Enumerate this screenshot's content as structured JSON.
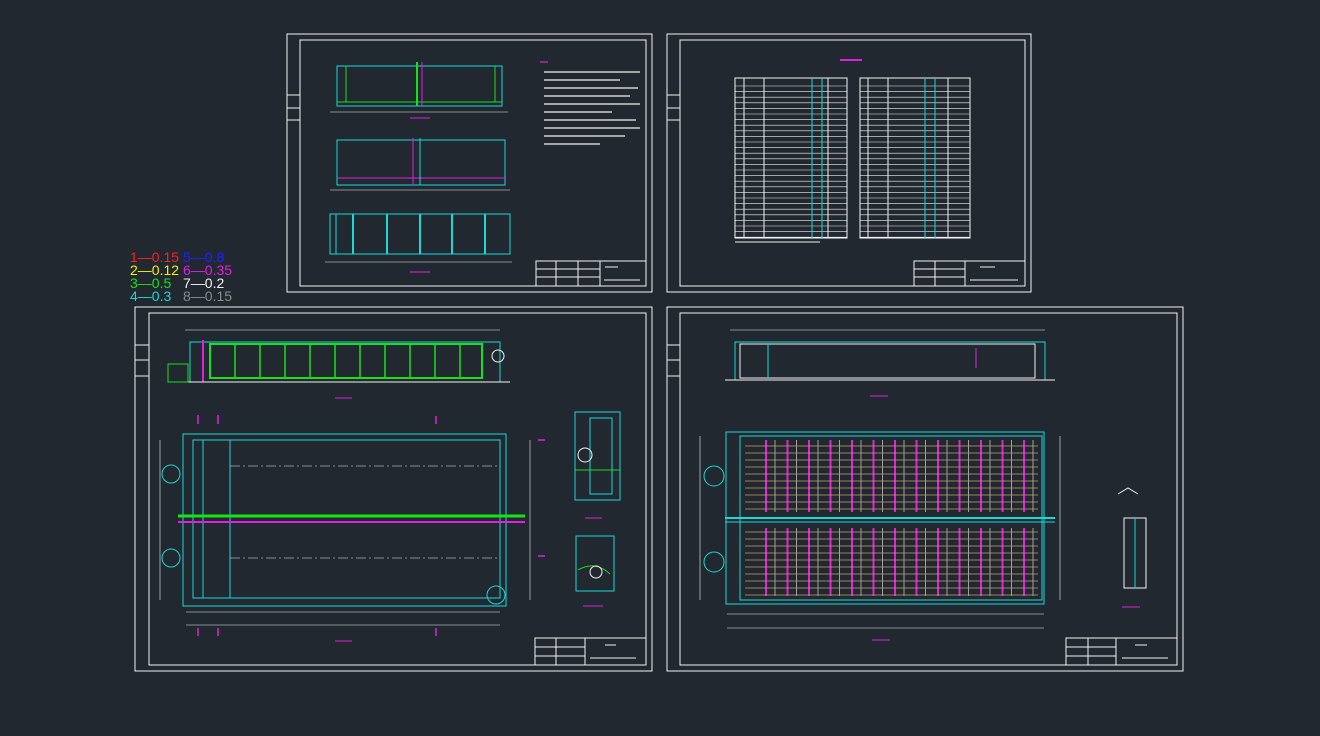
{
  "lineweight_legend": [
    {
      "text": "1—0.15",
      "color": "#ff2020"
    },
    {
      "text": "2—0.12",
      "color": "#f2f200"
    },
    {
      "text": "3—0.5",
      "color": "#19e019"
    },
    {
      "text": "4—0.3",
      "color": "#19d8d8"
    },
    {
      "text": "5—0.8",
      "color": "#2020ff"
    },
    {
      "text": "6—0.35",
      "color": "#e020e0"
    },
    {
      "text": "7—0.2",
      "color": "#f2f2f2"
    },
    {
      "text": "8—0.15",
      "color": "#8a8a8a"
    }
  ],
  "colors": {
    "background": "#212830",
    "frame": "#f2f2f2",
    "cyan": "#19d8d8",
    "green": "#19e019",
    "magenta": "#e020e0",
    "yellow": "#f2f200",
    "red": "#ff2020"
  }
}
